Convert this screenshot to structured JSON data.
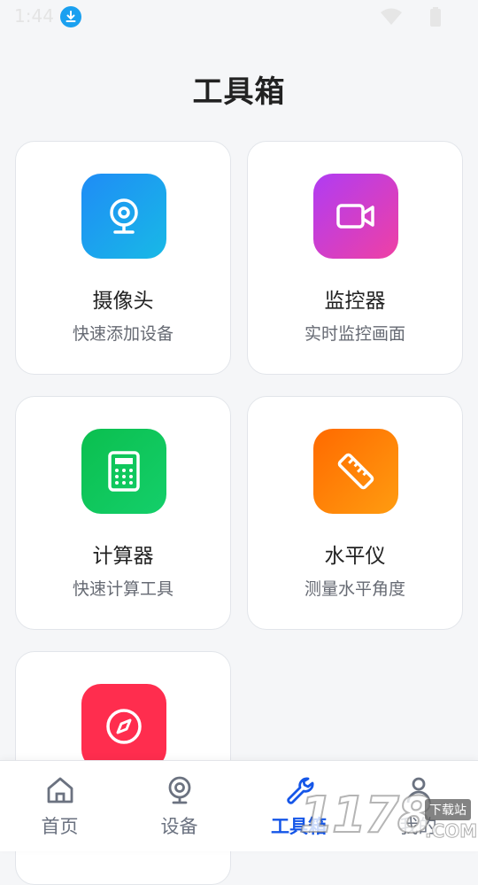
{
  "status_bar": {
    "time": "1:44"
  },
  "page": {
    "title": "工具箱"
  },
  "tools": [
    {
      "name": "摄像头",
      "desc": "快速添加设备",
      "icon": "webcam-icon",
      "gradient": [
        "#1f8cf6",
        "#18b9e6"
      ]
    },
    {
      "name": "监控器",
      "desc": "实时监控画面",
      "icon": "video-camera-icon",
      "gradient": [
        "#b03cf3",
        "#ef40a4"
      ]
    },
    {
      "name": "计算器",
      "desc": "快速计算工具",
      "icon": "calculator-icon",
      "gradient": [
        "#0bbf4f",
        "#14cf6a"
      ]
    },
    {
      "name": "水平仪",
      "desc": "测量水平角度",
      "icon": "ruler-icon",
      "gradient": [
        "#ff6a00",
        "#ff9c10"
      ]
    },
    {
      "name": "",
      "desc": "",
      "icon": "compass-icon",
      "gradient": [
        "#ff2d4e",
        "#ff2d4e"
      ]
    }
  ],
  "nav": {
    "items": [
      {
        "label": "首页",
        "icon": "home-icon"
      },
      {
        "label": "设备",
        "icon": "camera-icon"
      },
      {
        "label": "工具箱",
        "icon": "wrench-icon",
        "active": true
      },
      {
        "label": "我的",
        "icon": "person-icon"
      }
    ]
  },
  "watermark": {
    "digits": "1178",
    "tag": "下载站",
    "domain": ".COM"
  },
  "colors": {
    "accent": "#1556e8",
    "background": "#f5f6f8"
  }
}
